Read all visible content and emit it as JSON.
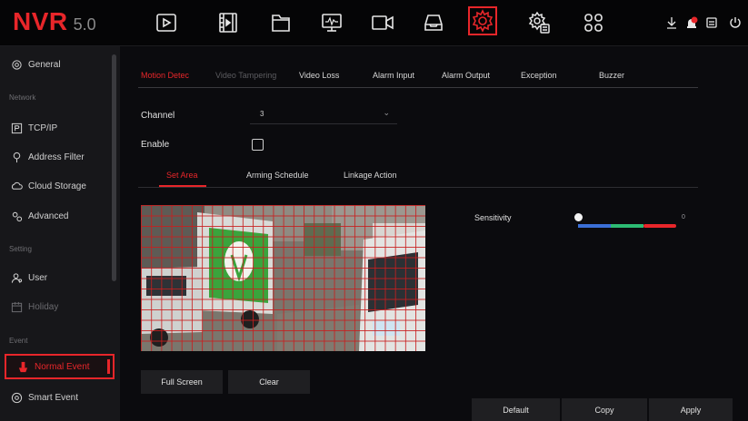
{
  "app": {
    "logo": "NVR",
    "version": "5.0"
  },
  "toolbar": {
    "icons": [
      "playback-icon",
      "video-clip-icon",
      "folder-icon",
      "monitor-icon",
      "camera-icon",
      "storage-icon",
      "settings-icon",
      "system-settings-icon",
      "apps-icon"
    ],
    "active": "settings-icon",
    "right_icons": [
      "download-icon",
      "alarm-icon",
      "disk-icon",
      "power-icon"
    ]
  },
  "sidebar": {
    "items": [
      {
        "label": "General",
        "icon": "gear-icon"
      },
      {
        "label": "Network",
        "type": "section"
      },
      {
        "label": "TCP/IP",
        "icon": "ip-icon"
      },
      {
        "label": "Address Filter",
        "icon": "filter-icon"
      },
      {
        "label": "Cloud Storage",
        "icon": "cloud-icon"
      },
      {
        "label": "Advanced",
        "icon": "advanced-gear-icon"
      },
      {
        "label": "Setting",
        "type": "section"
      },
      {
        "label": "User",
        "icon": "user-icon"
      },
      {
        "label": "Holiday",
        "icon": "calendar-icon"
      },
      {
        "label": "Event",
        "type": "section"
      },
      {
        "label": "Normal Event",
        "icon": "event-icon",
        "active": true
      },
      {
        "label": "Smart Event",
        "icon": "smart-event-icon"
      }
    ]
  },
  "tabs": {
    "items": [
      "Motion Detec",
      "Video Tampering",
      "Video Loss",
      "Alarm Input",
      "Alarm Output",
      "Exception",
      "Buzzer"
    ],
    "active": "Motion Detec"
  },
  "form": {
    "channel_label": "Channel",
    "channel_value": "3",
    "enable_label": "Enable",
    "enable_checked": false
  },
  "subtabs": {
    "items": [
      "Set Area",
      "Arming Schedule",
      "Linkage Action"
    ],
    "active": "Set Area"
  },
  "sensitivity": {
    "label": "Sensitivity",
    "value": "0",
    "level": 0
  },
  "buttons": {
    "full_screen": "Full Screen",
    "clear": "Clear",
    "default": "Default",
    "copy": "Copy",
    "apply": "Apply"
  },
  "colors": {
    "accent": "#e8262a",
    "background": "#0b0b0e",
    "sidebar": "#17171a"
  }
}
